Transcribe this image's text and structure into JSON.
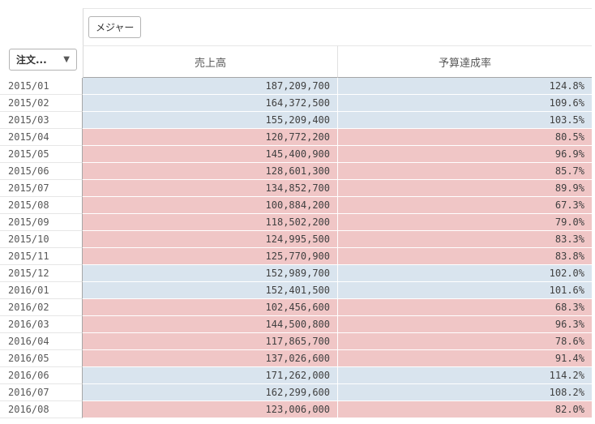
{
  "table": {
    "dimension_label": "注文...",
    "measure_button_label": "メジャー",
    "columns": [
      "売上高",
      "予算達成率"
    ],
    "colors": {
      "above_target": "#d9e4ee",
      "below_target": "#f0c6c6"
    },
    "rows": [
      {
        "period": "2015/01",
        "sales": "187,209,700",
        "rate": "124.8%",
        "status": "above"
      },
      {
        "period": "2015/02",
        "sales": "164,372,500",
        "rate": "109.6%",
        "status": "above"
      },
      {
        "period": "2015/03",
        "sales": "155,209,400",
        "rate": "103.5%",
        "status": "above"
      },
      {
        "period": "2015/04",
        "sales": "120,772,200",
        "rate": "80.5%",
        "status": "below"
      },
      {
        "period": "2015/05",
        "sales": "145,400,900",
        "rate": "96.9%",
        "status": "below"
      },
      {
        "period": "2015/06",
        "sales": "128,601,300",
        "rate": "85.7%",
        "status": "below"
      },
      {
        "period": "2015/07",
        "sales": "134,852,700",
        "rate": "89.9%",
        "status": "below"
      },
      {
        "period": "2015/08",
        "sales": "100,884,200",
        "rate": "67.3%",
        "status": "below"
      },
      {
        "period": "2015/09",
        "sales": "118,502,200",
        "rate": "79.0%",
        "status": "below"
      },
      {
        "period": "2015/10",
        "sales": "124,995,500",
        "rate": "83.3%",
        "status": "below"
      },
      {
        "period": "2015/11",
        "sales": "125,770,900",
        "rate": "83.8%",
        "status": "below"
      },
      {
        "period": "2015/12",
        "sales": "152,989,700",
        "rate": "102.0%",
        "status": "above"
      },
      {
        "period": "2016/01",
        "sales": "152,401,500",
        "rate": "101.6%",
        "status": "above"
      },
      {
        "period": "2016/02",
        "sales": "102,456,600",
        "rate": "68.3%",
        "status": "below"
      },
      {
        "period": "2016/03",
        "sales": "144,500,800",
        "rate": "96.3%",
        "status": "below"
      },
      {
        "period": "2016/04",
        "sales": "117,865,700",
        "rate": "78.6%",
        "status": "below"
      },
      {
        "period": "2016/05",
        "sales": "137,026,600",
        "rate": "91.4%",
        "status": "below"
      },
      {
        "period": "2016/06",
        "sales": "171,262,000",
        "rate": "114.2%",
        "status": "above"
      },
      {
        "period": "2016/07",
        "sales": "162,299,600",
        "rate": "108.2%",
        "status": "above"
      },
      {
        "period": "2016/08",
        "sales": "123,006,000",
        "rate": "82.0%",
        "status": "below"
      }
    ]
  }
}
